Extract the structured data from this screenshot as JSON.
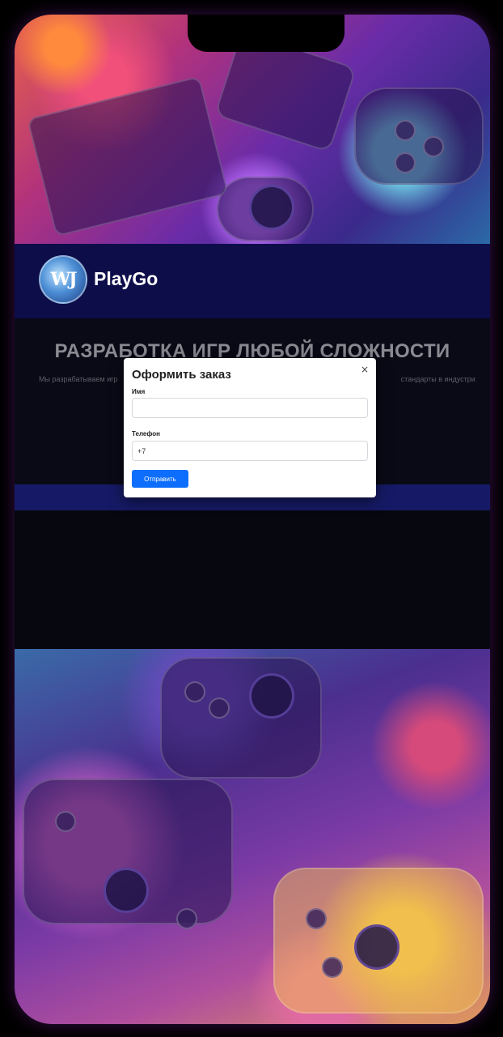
{
  "header": {
    "logo_text": "WJ",
    "brand": "PlayGo"
  },
  "hero": {
    "title": "РАЗРАБОТКА ИГР ЛЮБОЙ СЛОЖНОСТИ",
    "text_left": "Мы разрабатываем игр",
    "text_right": "стандарты в индустри"
  },
  "modal": {
    "title": "Оформить заказ",
    "close_label": "×",
    "name_label": "Имя",
    "name_value": "",
    "phone_label": "Телефон",
    "phone_value": "+7",
    "submit_label": "Отправить"
  },
  "colors": {
    "header_bg": "#0d0d4a",
    "page_bg": "#0a0a17",
    "button_primary": "#0d6efd"
  }
}
